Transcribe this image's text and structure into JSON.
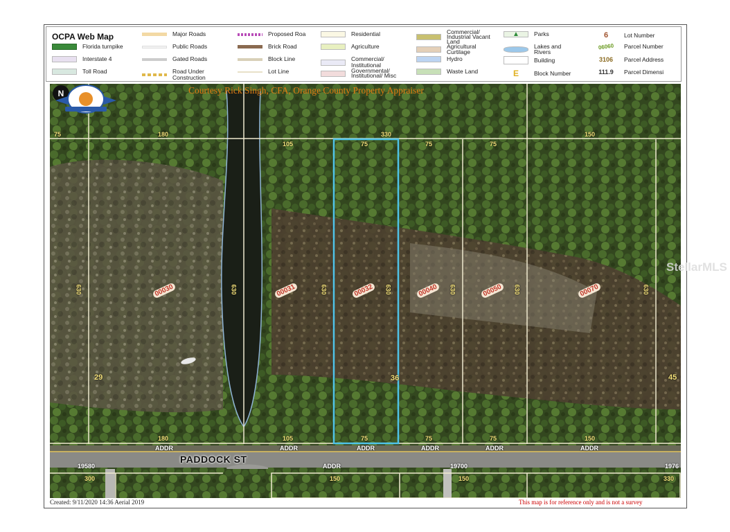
{
  "legend": {
    "title": "OCPA Web Map",
    "items": [
      {
        "label": "Florida turnpike",
        "kind": "sym",
        "color": "#3a8a3a"
      },
      {
        "label": "Interstate 4",
        "kind": "sym",
        "color": "#d94a6a"
      },
      {
        "label": "Toll Road",
        "kind": "sym",
        "color": "#6a9a8a"
      },
      {
        "label": "Major Roads",
        "kind": "line",
        "color": "#f3d9a4"
      },
      {
        "label": "Public Roads",
        "kind": "line",
        "color": "#ffffff"
      },
      {
        "label": "Gated Roads",
        "kind": "line",
        "color": "#cccccc"
      },
      {
        "label": "Road Under Construction",
        "kind": "line",
        "color": "#e0b84a"
      },
      {
        "label": "Proposed Roa",
        "kind": "line",
        "color": "#b84ab8"
      },
      {
        "label": "Brick Road",
        "kind": "line",
        "color": "#8a6a50"
      },
      {
        "label": "Block Line",
        "kind": "line",
        "color": "#d8d0b8"
      },
      {
        "label": "Lot Line",
        "kind": "line",
        "color": "#e8e0c8"
      },
      {
        "label": "Residential",
        "kind": "swatch",
        "color": "#fbf8e4"
      },
      {
        "label": "Agriculture",
        "kind": "swatch",
        "color": "#e8f0c0"
      },
      {
        "label": "Commercial/ Institutional",
        "kind": "swatch",
        "color": "#eaeaf6"
      },
      {
        "label": "Governmental/ Institutional/ Misc",
        "kind": "swatch",
        "color": "#f2dcdc"
      },
      {
        "label": "Commercial/ Industrial Vacant Land",
        "kind": "swatch",
        "color": "#c8c070"
      },
      {
        "label": "Agricultural Curtilage",
        "kind": "swatch",
        "color": "#e4d0b8"
      },
      {
        "label": "Hydro",
        "kind": "swatch",
        "color": "#bcd4f2"
      },
      {
        "label": "Waste Land",
        "kind": "swatch",
        "color": "#c8e0b8"
      },
      {
        "label": "Parks",
        "kind": "sym",
        "color": "#2e8b3a"
      },
      {
        "label": "Lakes and Rivers",
        "kind": "sym",
        "color": "#9cc8ea"
      },
      {
        "label": "Building",
        "kind": "swatch",
        "color": "#ffffff"
      },
      {
        "label": "Block Number",
        "kind": "text",
        "sym": "E",
        "color": "#e0b020"
      },
      {
        "label": "Lot Number",
        "kind": "text",
        "sym": "6",
        "color": "#a0522d"
      },
      {
        "label": "Parcel Number",
        "kind": "text",
        "sym": "06060",
        "color": "#6a9a20"
      },
      {
        "label": "Parcel Address",
        "kind": "text",
        "sym": "3106",
        "color": "#8a6a20"
      },
      {
        "label": "Parcel Dimensi",
        "kind": "text",
        "sym": "111.9",
        "color": "#333333"
      }
    ]
  },
  "map": {
    "courtesy": "Courtesy Rick Singh, CFA, Orange County Property Appraiser",
    "compass": "N",
    "seal_text": "RICK SINGH, CFA",
    "top_dims": [
      "75",
      "180",
      "330",
      "105",
      "75",
      "75",
      "75",
      "150"
    ],
    "side_dims": [
      "630",
      "630",
      "630",
      "630",
      "630",
      "630",
      "630"
    ],
    "parcels": [
      "00030",
      "00031",
      "00032",
      "00040",
      "00050",
      "00070"
    ],
    "lot_numbers": [
      "29",
      "36",
      "45"
    ],
    "bottom_dims": [
      "180",
      "105",
      "75",
      "75",
      "75",
      "150"
    ],
    "addr_labels": [
      "ADDR",
      "ADDR",
      "ADDR",
      "ADDR",
      "ADDR",
      "ADDR",
      "ADDR"
    ],
    "street": "PADDOCK ST",
    "south": {
      "addr_left": "19580",
      "addr_mid": "ADDR",
      "addr_right_mid": "19700",
      "addr_far": "1976",
      "dims": [
        "300",
        "150",
        "150",
        "330"
      ]
    }
  },
  "footer": {
    "created": "Created: 9/11/2020 14:36   Aerial 2019",
    "disclaimer": "This map is for reference only and is not a survey"
  },
  "watermark": "StellarMLS"
}
